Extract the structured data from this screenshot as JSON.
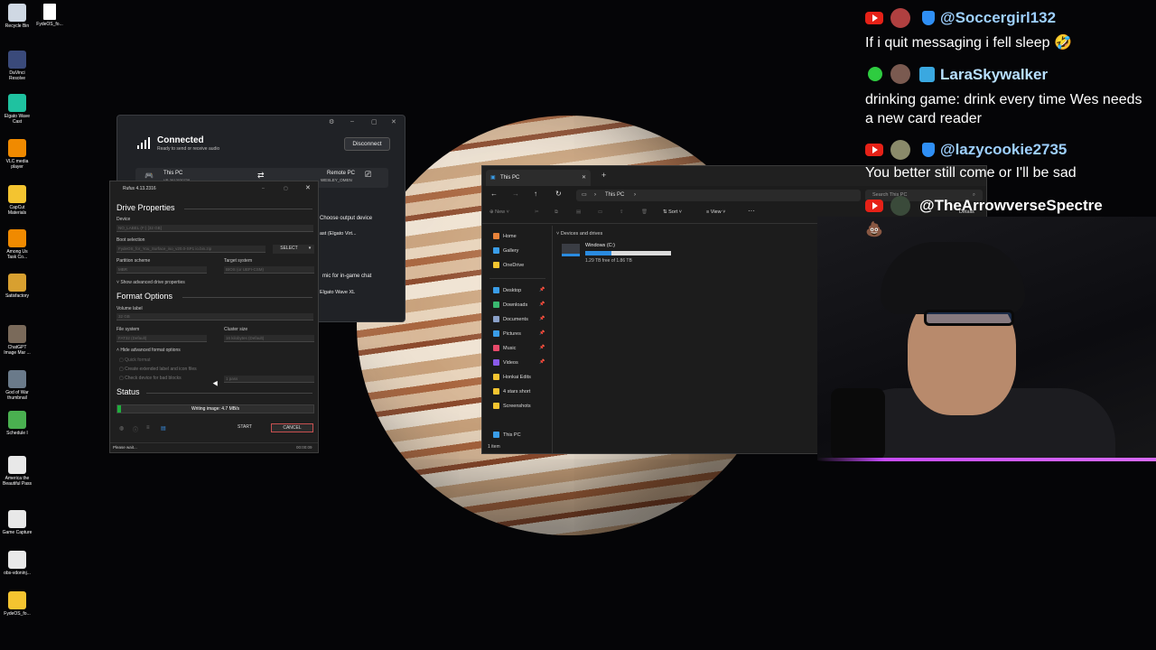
{
  "desktop": {
    "icons": [
      {
        "label": "Recycle Bin",
        "icon": "recycle-bin-icon",
        "color": "#cfd8e3"
      },
      {
        "label": "DaVinci Resolve",
        "icon": "davinci-icon",
        "color": "#3a4a7a"
      },
      {
        "label": "Elgato Wave Cast",
        "icon": "elgato-icon",
        "color": "#1fc2a0"
      },
      {
        "label": "VLC media player",
        "icon": "vlc-icon",
        "color": "#f08a00"
      },
      {
        "label": "CapCut Materials",
        "icon": "folder-icon",
        "color": "#f4c430"
      },
      {
        "label": "Among Us Task Co...",
        "icon": "vlc-icon",
        "color": "#f08a00"
      },
      {
        "label": "Satisfactory",
        "icon": "satisfactory-icon",
        "color": "#d8a030"
      },
      {
        "label": "ChatGPT Image Mar ...",
        "icon": "image-icon",
        "color": "#7a6a5a"
      },
      {
        "label": "God of War thumbnail",
        "icon": "image-icon",
        "color": "#6a7a8a"
      },
      {
        "label": "Schedule I",
        "icon": "schedule-icon",
        "color": "#4ab050"
      },
      {
        "label": "America the Beautiful Pass",
        "icon": "pdf-icon",
        "color": "#e8e8e8"
      },
      {
        "label": "Game Capture",
        "icon": "game-capture-icon",
        "color": "#e8e8e8"
      },
      {
        "label": "obs-vdoninj...",
        "icon": "download-icon",
        "color": "#e8e8e8"
      },
      {
        "label": "FydeOS_fo...",
        "icon": "folder-icon",
        "color": "#f4c430"
      }
    ],
    "icon2": {
      "label": "FydeOS_fo...",
      "icon": "file-icon"
    }
  },
  "wave": {
    "title": "Connected",
    "subtitle": "Ready to send or receive audio",
    "disconnect": "Disconnect",
    "this_pc": "This PC",
    "this_pc_sub": "VR-3613030738",
    "remote_pc": "Remote PC",
    "remote_pc_sub": "WESLEY_OMEN",
    "choose_output": "Choose output device",
    "output_value": "ast (Elgato Virt...",
    "mic_label": "mic for in-game chat",
    "mic_value": "Elgato Wave XL"
  },
  "rufus": {
    "title": "Rufus 4.13.2316",
    "drive_properties": "Drive Properties",
    "device_label": "Device",
    "device_value": "NO_LABEL (F:) [32 GB]",
    "boot_label": "Boot selection",
    "boot_value": "FydeOS_for_You_Surface_iso_v20.0-SP1 io.bin.zip",
    "select": "SELECT",
    "partition_label": "Partition scheme",
    "partition_value": "MBR",
    "target_label": "Target system",
    "target_value": "BIOS (or UEFI-CSM)",
    "advanced_drive": "Show advanced drive properties",
    "format_options": "Format Options",
    "volume_label": "Volume label",
    "volume_value": "32 GB",
    "fs_label": "File system",
    "fs_value": "FAT32 (Default)",
    "cluster_label": "Cluster size",
    "cluster_value": "16 kilobytes (Default)",
    "advanced_format": "Hide advanced format options",
    "quick_format": "Quick format",
    "extended_label": "Create extended label and icon files",
    "bad_blocks": "Check device for bad blocks",
    "passes": "1 pass",
    "status": "Status",
    "progress_text": "Writing image: 4.7 MB/s",
    "progress_value": 0.02,
    "start": "START",
    "cancel": "CANCEL",
    "footer_status": "Please wait...",
    "footer_time": "00:00:09"
  },
  "explorer": {
    "tab_title": "This PC",
    "address": "This PC",
    "search_placeholder": "Search This PC",
    "new": "New",
    "sort": "Sort",
    "view": "View",
    "details": "Details",
    "section": "Devices and drives",
    "drive_name": "Windows (C:)",
    "drive_free": "1.29 TB free of 1.86 TB",
    "drive_used_fraction": 0.31,
    "sidebar": [
      {
        "label": "Home",
        "color": "#e8833a"
      },
      {
        "label": "Gallery",
        "color": "#3a9de8"
      },
      {
        "label": "OneDrive",
        "color": "#f4c430"
      },
      {
        "label": "Desktop",
        "color": "#3a9de8"
      },
      {
        "label": "Downloads",
        "color": "#3ab870"
      },
      {
        "label": "Documents",
        "color": "#8aa0c8"
      },
      {
        "label": "Pictures",
        "color": "#3a9de8"
      },
      {
        "label": "Music",
        "color": "#e84a6a"
      },
      {
        "label": "Videos",
        "color": "#8a5ae8"
      },
      {
        "label": "Honkai Edits",
        "color": "#f4c430"
      },
      {
        "label": "4 stars short",
        "color": "#f4c430"
      },
      {
        "label": "Screenshots",
        "color": "#f4c430"
      },
      {
        "label": "This PC",
        "color": "#3a9de8"
      }
    ],
    "status_count": "1 item"
  },
  "chat": [
    {
      "user": "@Soccergirl132",
      "message": "If i quit messaging i fell sleep 🤣",
      "user_color": "#9ed0ff"
    },
    {
      "user": "LaraSkywalker",
      "message": "drinking game: drink every time Wes needs a new card reader",
      "user_color": "#b8e0ff"
    },
    {
      "user": "@lazycookie2735",
      "message": "You better still come or I'll be sad",
      "user_color": "#9ed0ff"
    },
    {
      "user": "@TheArrowverseSpectre",
      "message": "💩",
      "user_color": "#ffffff"
    }
  ]
}
